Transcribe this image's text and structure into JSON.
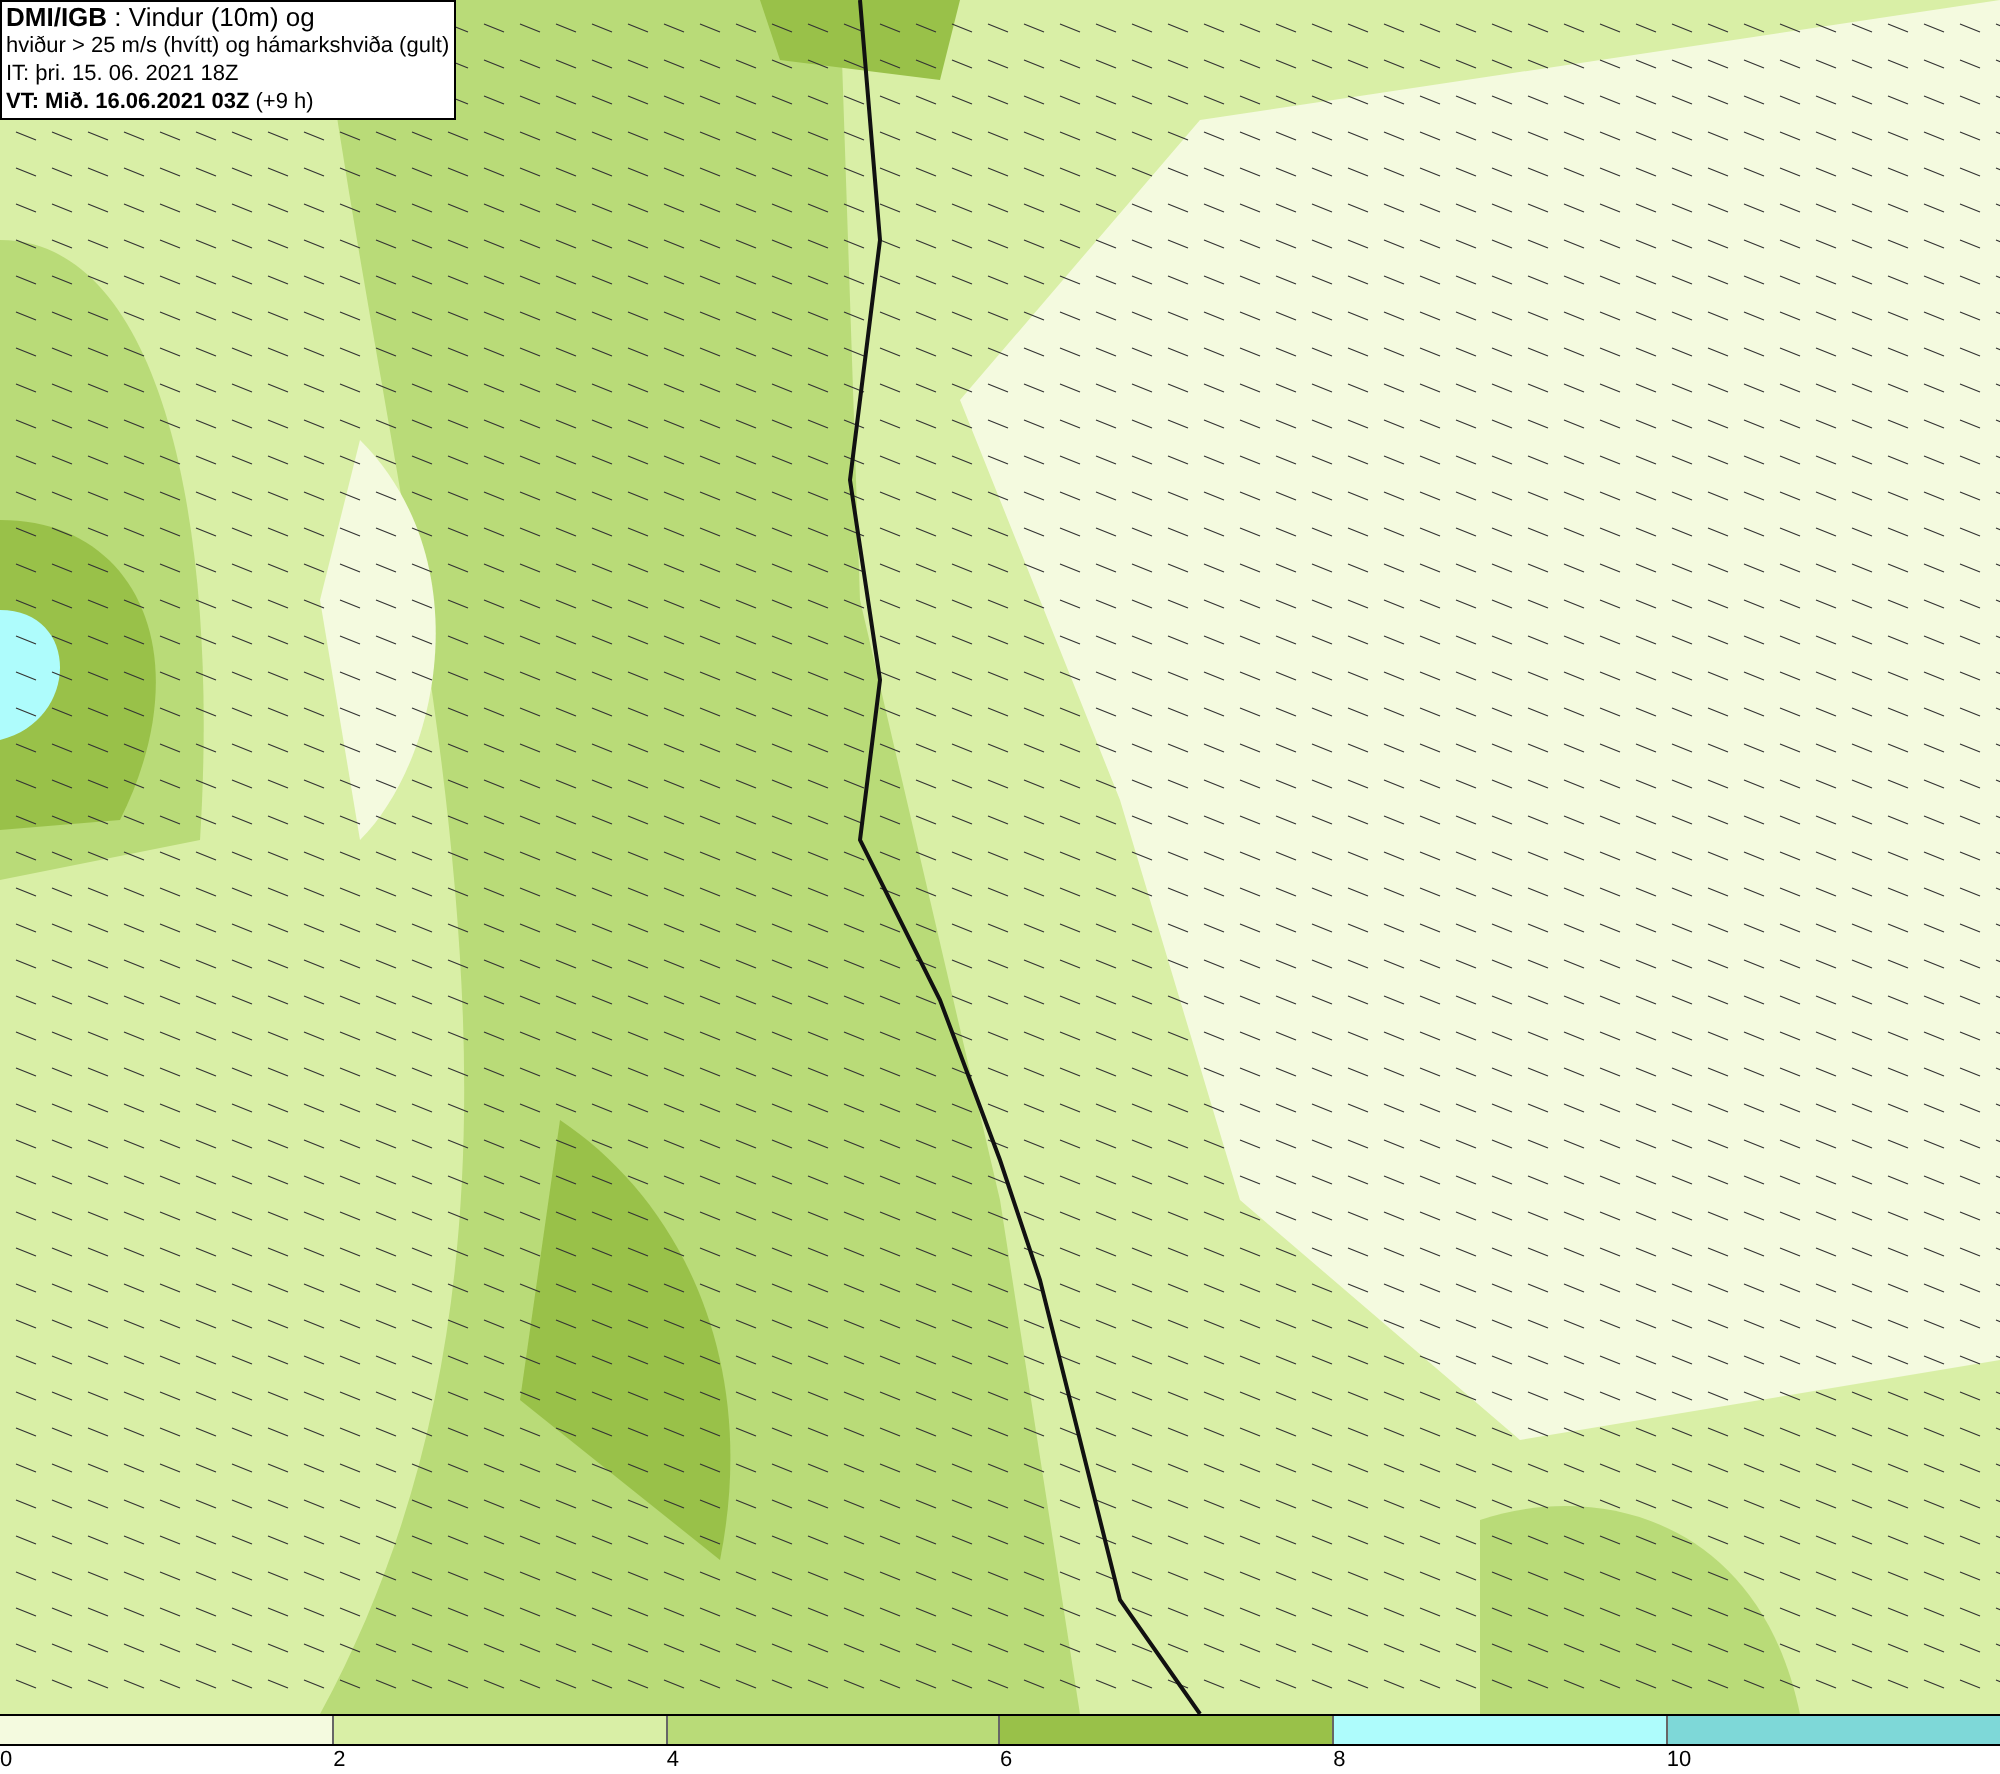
{
  "title_box": {
    "lines": [
      "**DMI/IGB** : Vindur (10m) og",
      "hviður > 25 m/s (hvítt) og hámarkshviða (gult)",
      "IT: þri. 15. 06. 2021 18Z",
      "**VT: Mið. 16.06.2021 03Z** (+9 h)"
    ]
  },
  "legend": {
    "bands": [
      {
        "color": "#f4fadf"
      },
      {
        "color": "#d9efa6"
      },
      {
        "color": "#b9db78"
      },
      {
        "color": "#99c149"
      },
      {
        "color": "#aefcfc"
      },
      {
        "color": "#7ed8d8"
      }
    ],
    "labels": [
      "0",
      "2",
      "4",
      "6",
      "8",
      "10"
    ]
  }
}
